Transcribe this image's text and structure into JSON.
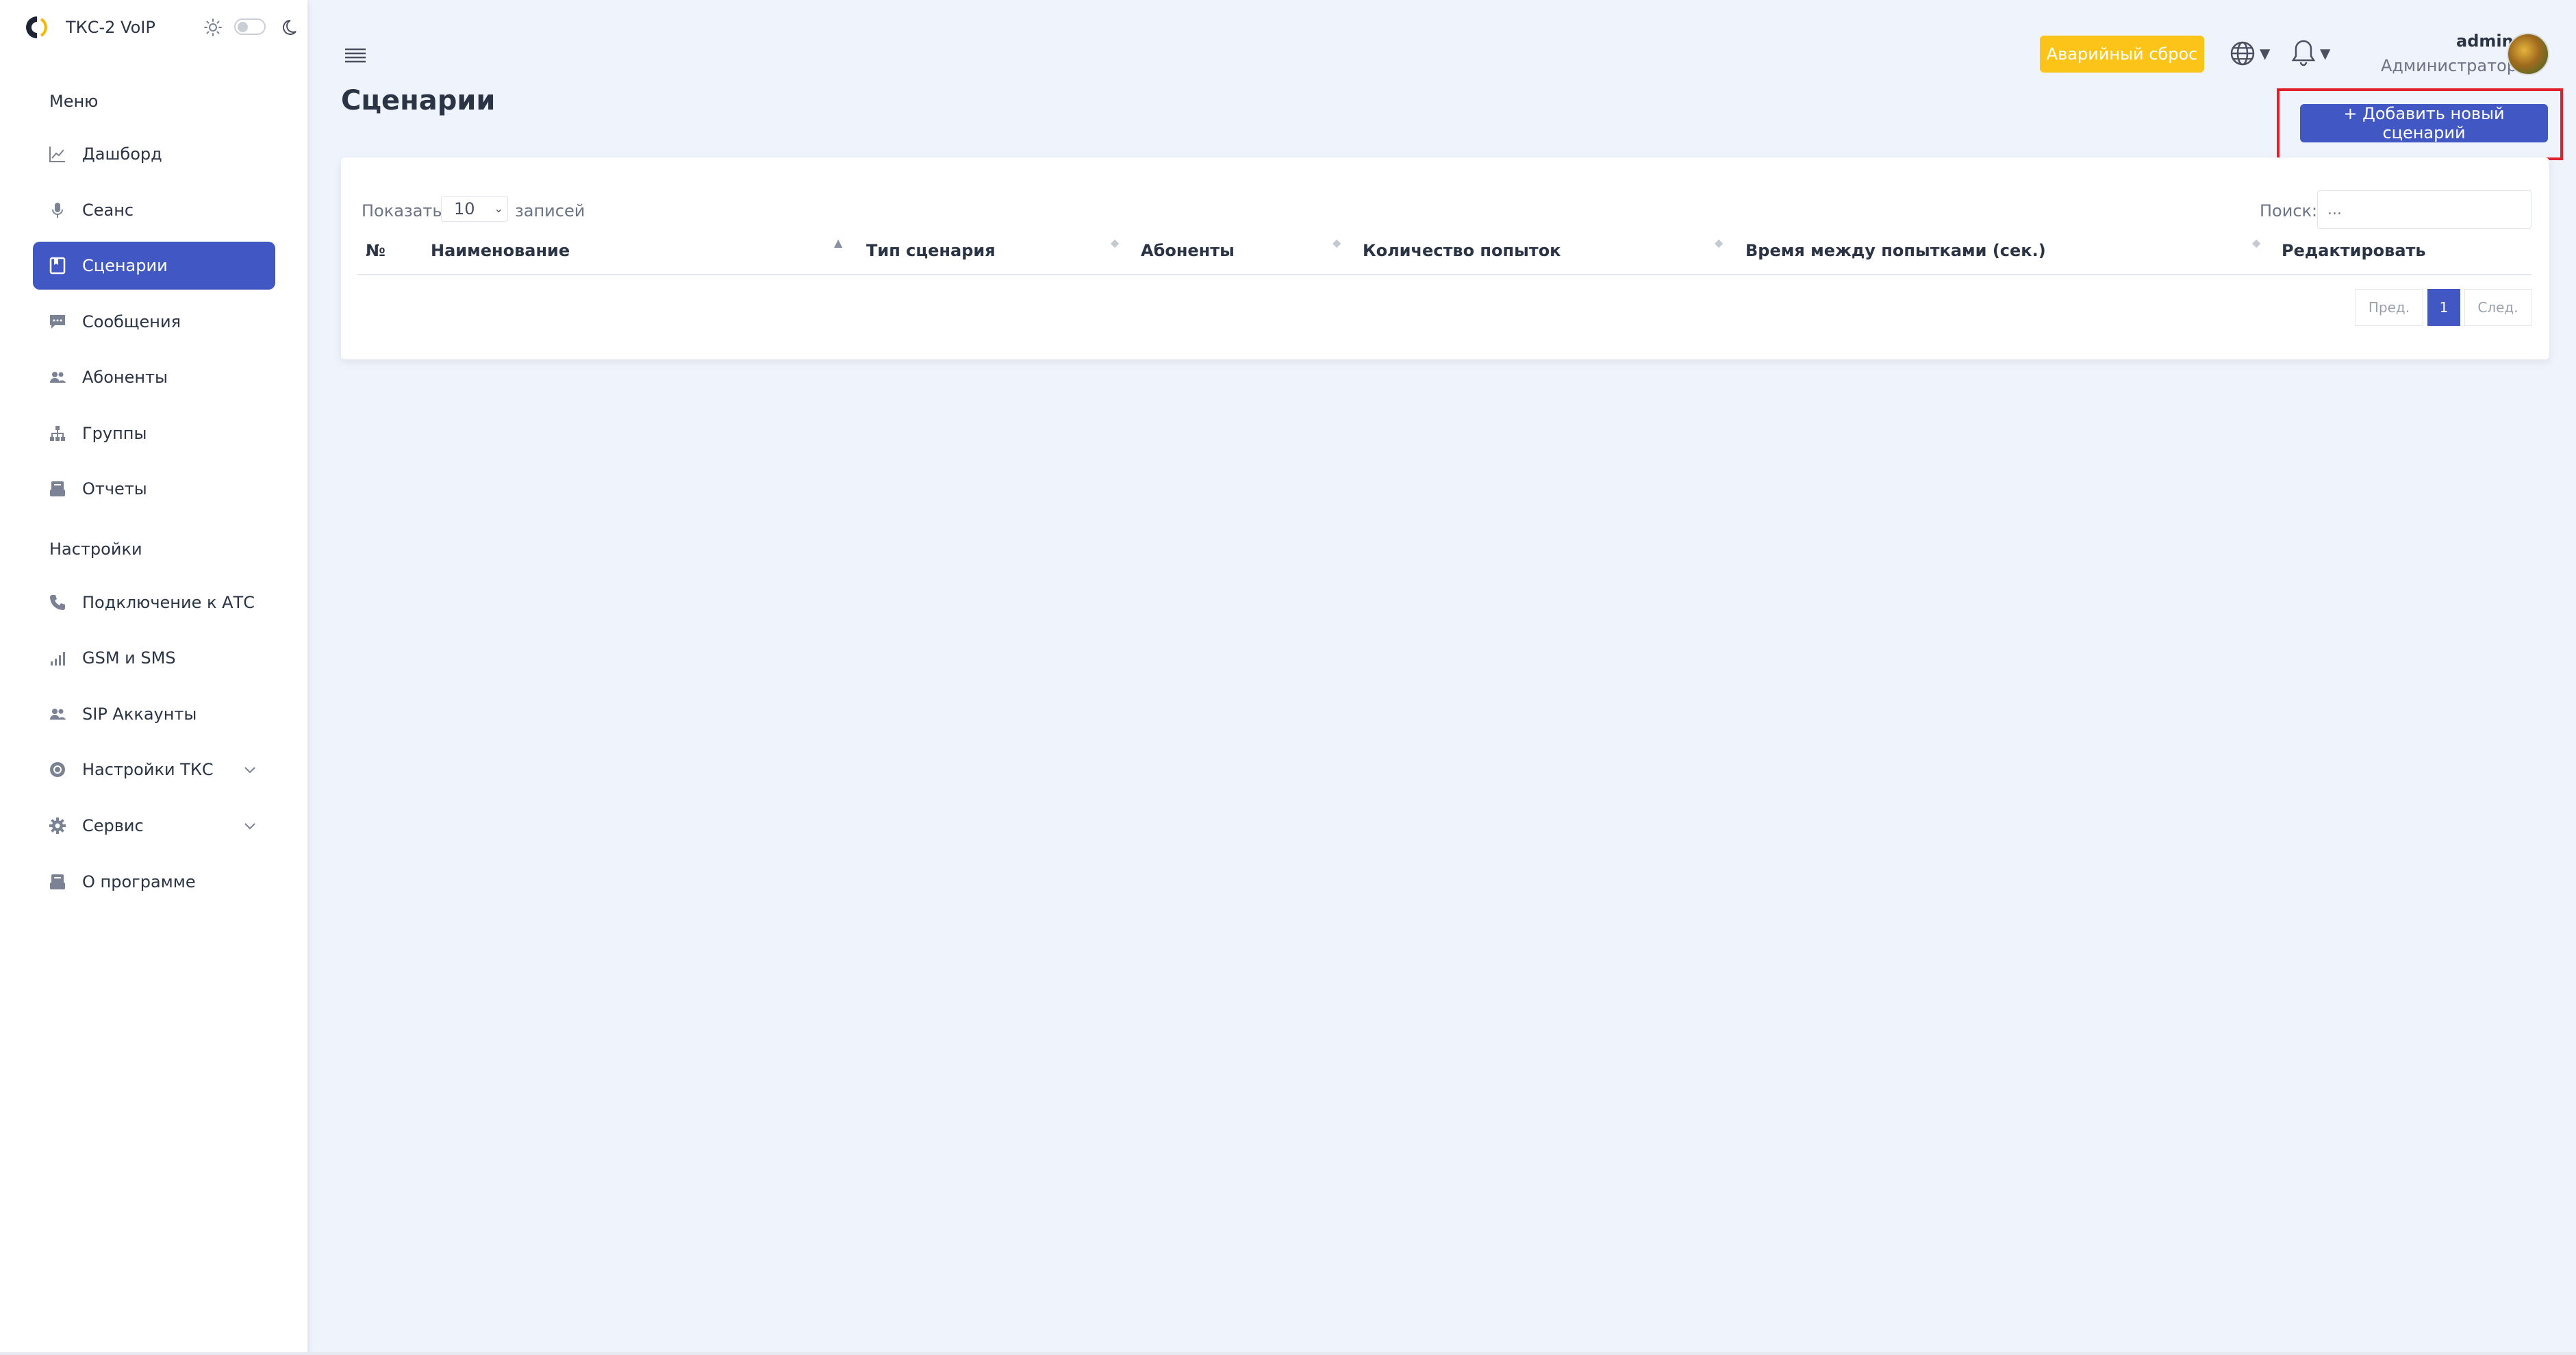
{
  "app": {
    "brand_name": "ТКС-2 VoIP"
  },
  "sidebar": {
    "menu_label": "Меню",
    "settings_label": "Настройки",
    "items": [
      {
        "label": "Дашборд",
        "icon": "chart-line-icon"
      },
      {
        "label": "Сеанс",
        "icon": "microphone-icon"
      },
      {
        "label": "Сценарии",
        "icon": "bookmark-icon",
        "active": true
      },
      {
        "label": "Сообщения",
        "icon": "message-icon"
      },
      {
        "label": "Абоненты",
        "icon": "users-icon"
      },
      {
        "label": "Группы",
        "icon": "hierarchy-icon"
      },
      {
        "label": "Отчеты",
        "icon": "report-icon"
      }
    ],
    "settings_items": [
      {
        "label": "Подключение к АТС",
        "icon": "phone-icon"
      },
      {
        "label": "GSM и SMS",
        "icon": "signal-icon"
      },
      {
        "label": "SIP Аккаунты",
        "icon": "users-icon"
      },
      {
        "label": "Настройки ТКС",
        "icon": "settings-circle-icon",
        "expandable": true
      },
      {
        "label": "Сервис",
        "icon": "gear-icon",
        "expandable": true
      },
      {
        "label": "О программе",
        "icon": "info-icon"
      }
    ]
  },
  "header": {
    "emergency_reset_label": "Аварийный сброс",
    "user_name": "admin",
    "user_role": "Администратор"
  },
  "page": {
    "title": "Сценарии",
    "add_button_label": "+ Добавить новый сценарий"
  },
  "table": {
    "show_label": "Показать",
    "page_size": "10",
    "entries_label": "записей",
    "search_label": "Поиск:",
    "search_placeholder": "...",
    "columns": [
      "№",
      "Наименование",
      "Тип сценария",
      "Абоненты",
      "Количество попыток",
      "Время между попытками (сек.)",
      "Редактировать"
    ],
    "rows": []
  },
  "pagination": {
    "prev_label": "Пред.",
    "current_page": "1",
    "next_label": "След."
  },
  "colors": {
    "accent": "#4158c4",
    "warning": "#fcc419",
    "highlight": "#e0202b",
    "background": "#eff3fc"
  }
}
